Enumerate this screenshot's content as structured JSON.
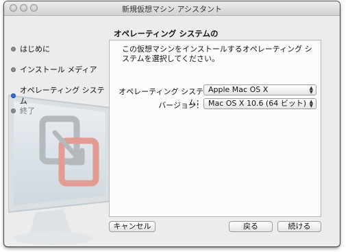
{
  "window": {
    "title": "新規仮想マシン アシスタント"
  },
  "sidebar": {
    "steps": [
      {
        "label": "はじめに"
      },
      {
        "label": "インストール メディア"
      },
      {
        "label": "オペレーティング システム"
      },
      {
        "label": "終了"
      }
    ]
  },
  "main": {
    "heading": "オペレーティング システムの選択",
    "description": "この仮想マシンをインストールするオペレーティング システムを選択してください。",
    "os_field": {
      "label": "オペレーティング システム：",
      "value": "Apple Mac OS X"
    },
    "version_field": {
      "label": "バージョン：",
      "value": "Mac OS X 10.6 (64 ビット)"
    }
  },
  "footer": {
    "cancel_label": "キャンセル",
    "back_label": "戻る",
    "continue_label": "続ける"
  },
  "colors": {
    "active_step": "#2f6fd8",
    "inactive_step": "#8c8c8c"
  },
  "icons": [
    "close-button",
    "minimize-button",
    "zoom-button",
    "vmware-fusion-logo",
    "popup-arrows-icon"
  ]
}
